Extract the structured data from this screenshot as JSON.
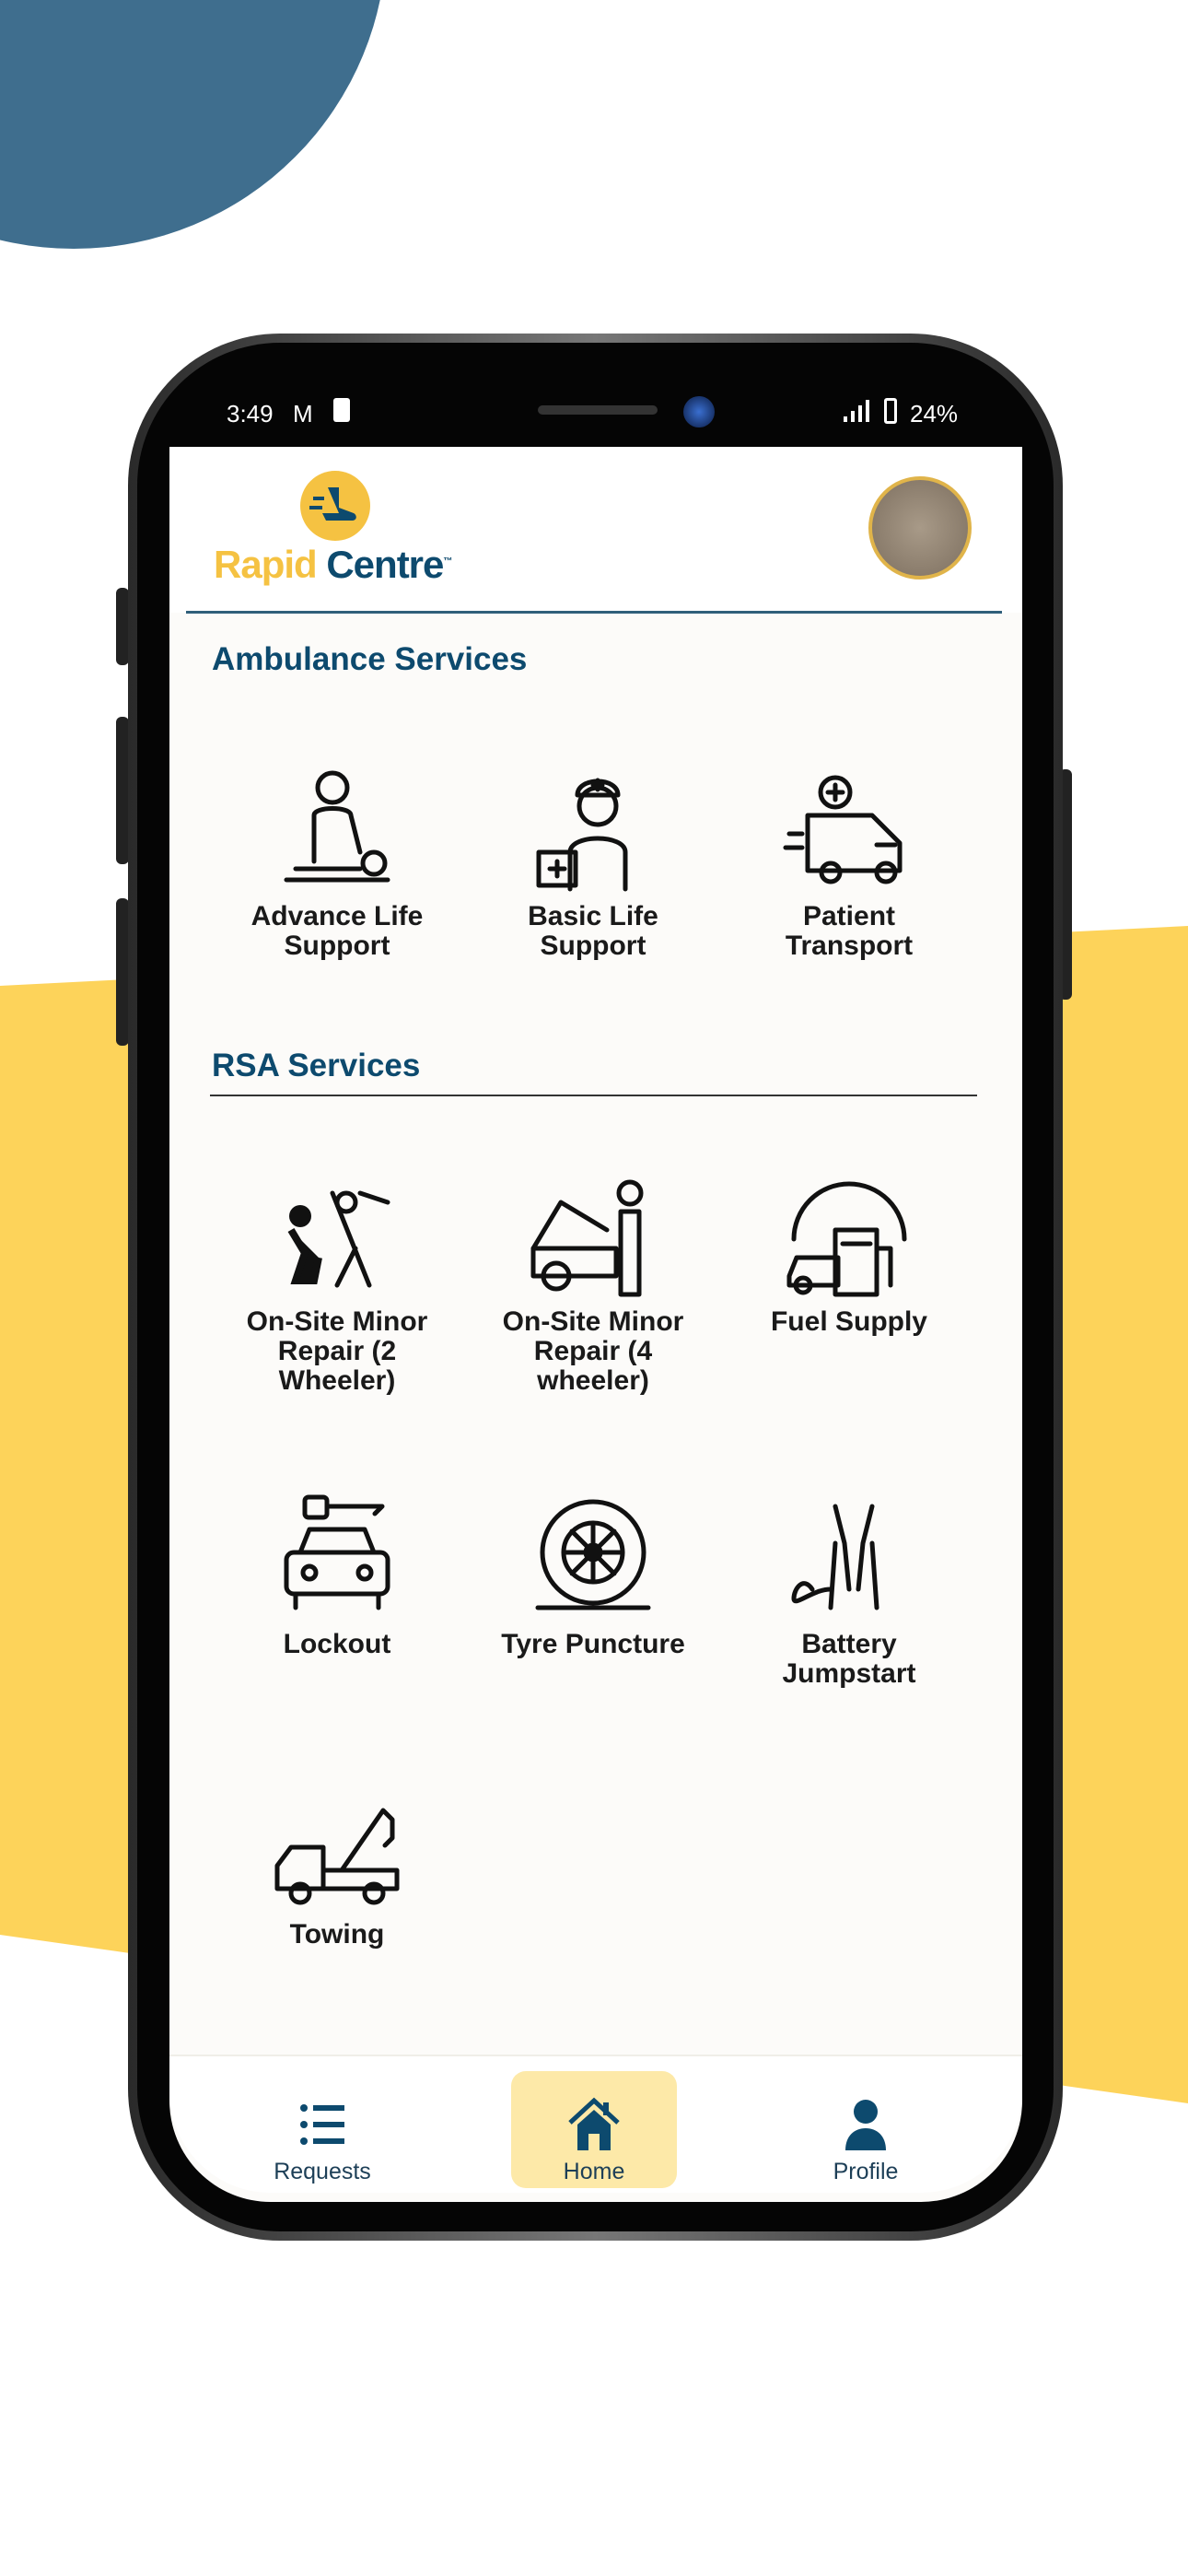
{
  "status_bar": {
    "time": "3:49",
    "battery": "24%",
    "icons": [
      "gmail-icon",
      "puzzle-icon",
      "signal-icon",
      "battery-icon"
    ]
  },
  "header": {
    "logo": {
      "word1": "Rapid",
      "word2": "Centre",
      "tm": "™"
    },
    "avatar": "profile-avatar"
  },
  "colors": {
    "primary": "#0d4a6e",
    "accent": "#f5c242",
    "nav_active_bg": "#fde9a8",
    "blob": "#3f6e8e",
    "yellow": "#fdd35a"
  },
  "ambulance": {
    "title": "Ambulance Services",
    "items": [
      {
        "label": "Advance Life Support",
        "lines": [
          "Advance Life",
          "Support"
        ],
        "icon": "cpr-icon"
      },
      {
        "label": "Basic Life Support",
        "lines": [
          "Basic Life",
          "Support"
        ],
        "icon": "paramedic-icon"
      },
      {
        "label": "Patient Transport",
        "lines": [
          "Patient",
          "Transport"
        ],
        "icon": "ambulance-icon"
      }
    ]
  },
  "rsa": {
    "title": "RSA Services",
    "items": [
      {
        "lines": [
          "On-Site Minor",
          "Repair (2",
          "Wheeler)"
        ],
        "icon": "bike-repair-icon"
      },
      {
        "lines": [
          "On-Site Minor",
          "Repair (4",
          "wheeler)"
        ],
        "icon": "car-repair-icon"
      },
      {
        "lines": [
          "Fuel Supply"
        ],
        "icon": "fuel-icon"
      },
      {
        "lines": [
          "Lockout"
        ],
        "icon": "car-key-icon"
      },
      {
        "lines": [
          "Tyre Puncture"
        ],
        "icon": "tyre-icon"
      },
      {
        "lines": [
          "Battery",
          "Jumpstart"
        ],
        "icon": "jumper-cable-icon"
      },
      {
        "lines": [
          "Towing"
        ],
        "icon": "tow-truck-icon"
      }
    ]
  },
  "nav": {
    "items": [
      {
        "label": "Requests",
        "icon": "list-icon"
      },
      {
        "label": "Home",
        "icon": "home-icon",
        "active": true
      },
      {
        "label": "Profile",
        "icon": "person-icon"
      }
    ]
  }
}
